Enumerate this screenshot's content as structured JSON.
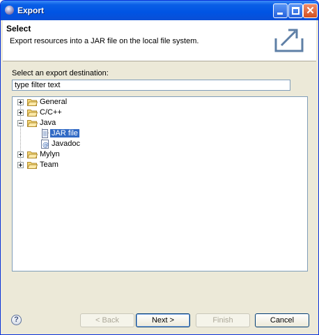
{
  "window": {
    "title": "Export"
  },
  "header": {
    "title": "Select",
    "description": "Export resources into a JAR file on the local file system."
  },
  "filter": {
    "label": "Select an export destination:",
    "value": "type filter text"
  },
  "tree": {
    "items": [
      {
        "label": "General",
        "expanded": false
      },
      {
        "label": "C/C++",
        "expanded": false
      },
      {
        "label": "Java",
        "expanded": true
      },
      {
        "label": "JAR file",
        "selected": true
      },
      {
        "label": "Javadoc"
      },
      {
        "label": "Mylyn",
        "expanded": false
      },
      {
        "label": "Team",
        "expanded": false
      }
    ]
  },
  "buttons": {
    "back": "< Back",
    "next": "Next >",
    "finish": "Finish",
    "cancel": "Cancel"
  },
  "colors": {
    "titlebar": "#0054e3",
    "selection": "#316ac5",
    "dialog_bg": "#ece9d8"
  }
}
